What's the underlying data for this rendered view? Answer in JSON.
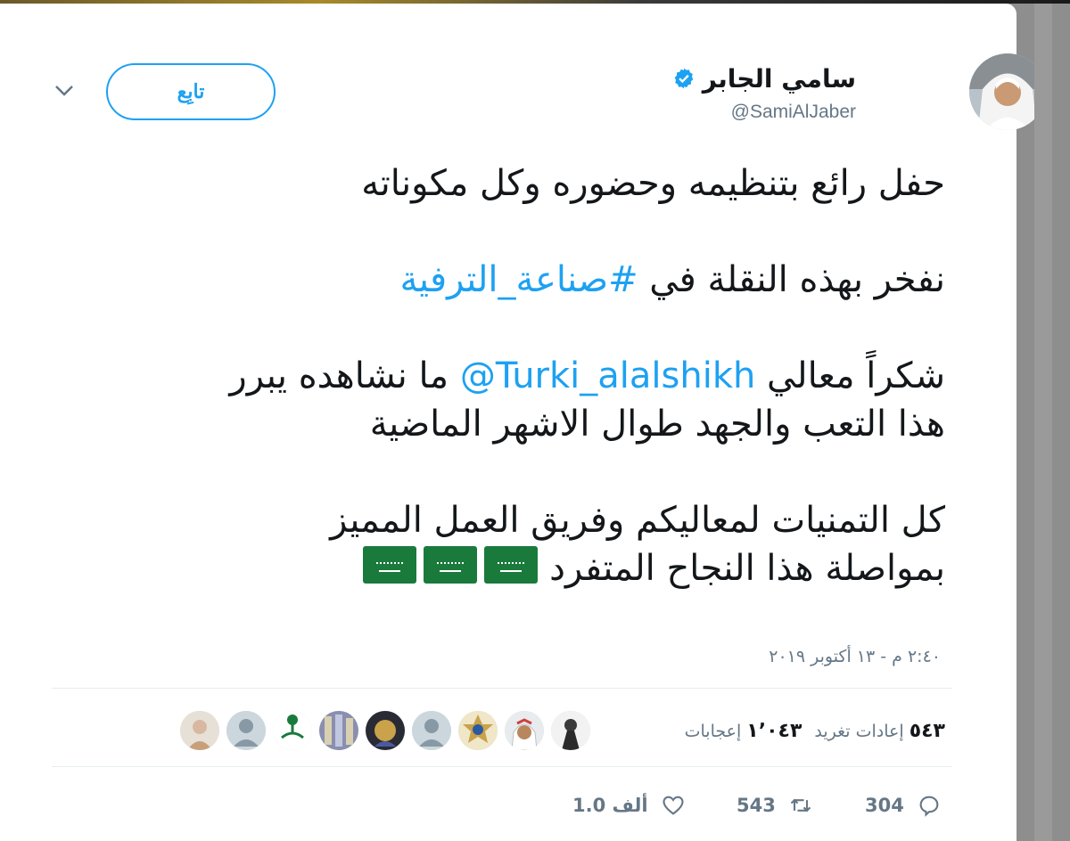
{
  "tweet": {
    "author_name": "سامي الجابر",
    "handle": "@SamiAlJaber",
    "follow_label": "تابِع",
    "lines": [
      "حفل رائع بتنظيمه وحضوره وكل مكوناته",
      "نفخر بهذه النقلة في ",
      "#صناعة_الترفية",
      "شكراً معالي ",
      "@Turki_alalshikh",
      " ما نشاهده يبرر",
      "هذا التعب والجهد طوال الاشهر الماضية",
      "كل التمنيات لمعاليكم وفريق العمل المميز",
      "بمواصلة هذا النجاح المتفرد "
    ],
    "timestamp": "٢:٤٠ م - ١٣ أكتوبر ٢٠١٩",
    "stats": {
      "retweets_count": "٥٤٣",
      "retweets_label": "إعادات تغريد",
      "likes_count": "١٬٠٤٣",
      "likes_label": "إعجابات"
    },
    "actions": {
      "replies": "304",
      "retweets": "543",
      "likes": "1.0 ألف"
    }
  },
  "colors": {
    "accent": "#1da1f2",
    "text": "#14171a",
    "muted": "#657786",
    "flag": "#1a7a3c"
  },
  "icons": [
    "verified-badge-icon",
    "chevron-down-icon",
    "reply-icon",
    "retweet-icon",
    "like-icon",
    "saudi-flag-icon"
  ]
}
